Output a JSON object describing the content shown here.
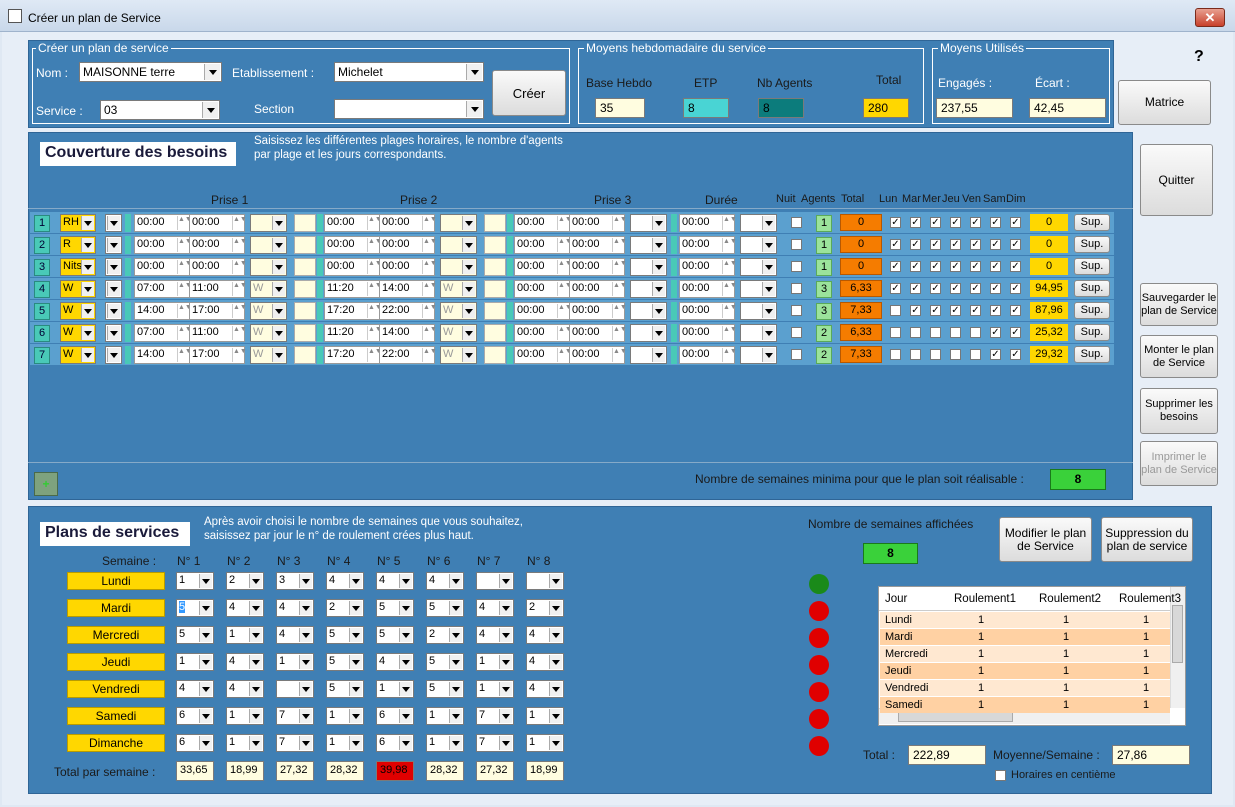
{
  "window": {
    "title": "Créer un plan de Service",
    "close": "✕"
  },
  "create": {
    "legend": "Créer un plan de service",
    "nom_label": "Nom :",
    "nom_value": "MAISONNE terre",
    "etab_label": "Etablissement :",
    "etab_value": "Michelet",
    "service_label": "Service :",
    "service_value": "03",
    "section_label": "Section",
    "section_value": "",
    "creer": "Créer"
  },
  "moyens": {
    "legend": "Moyens hebdomadaire du service",
    "base_label": "Base Hebdo",
    "base_value": "35",
    "etp_label": "ETP",
    "etp_value": "8",
    "nb_label": "Nb Agents",
    "nb_value": "8",
    "total_label": "Total",
    "total_value": "280"
  },
  "utilises": {
    "legend": "Moyens Utilisés",
    "engages_label": "Engagés :",
    "engages_value": "237,55",
    "ecart_label": "Écart :",
    "ecart_value": "42,45"
  },
  "help": "?",
  "buttons": {
    "matrice": "Matrice",
    "quitter": "Quitter",
    "sauvegarder": "Sauvegarder le plan de Service",
    "monter": "Monter le plan de Service",
    "supprimer": "Supprimer les besoins",
    "imprimer": "Imprimer le plan de Service",
    "modifier": "Modifier le plan de Service",
    "suppression": "Suppression du plan de service",
    "add": "+"
  },
  "couverture": {
    "title": "Couverture des besoins",
    "desc1": "Saisissez les différentes plages horaires, le nombre d'agents",
    "desc2": "par plage et les jours correspondants.",
    "headers": {
      "prise1": "Prise 1",
      "prise2": "Prise 2",
      "prise3": "Prise 3",
      "duree": "Durée",
      "nuit": "Nuit",
      "agents": "Agents",
      "total": "Total",
      "lun": "Lun",
      "mar": "Mar",
      "mer": "Mer",
      "jeu": "Jeu",
      "ven": "Ven",
      "sam": "Sam",
      "dim": "Dim"
    },
    "rows": [
      {
        "n": "1",
        "code": "RH",
        "p1a": "00:00",
        "p1b": "00:00",
        "p1w": "",
        "p2a": "00:00",
        "p2b": "00:00",
        "p2w": "",
        "p3a": "00:00",
        "p3b": "00:00",
        "duree": "00:00",
        "agents": "1",
        "total": "0",
        "days": [
          1,
          1,
          1,
          1,
          1,
          1,
          1
        ],
        "sum": "0",
        "sup": "Sup."
      },
      {
        "n": "2",
        "code": "R",
        "p1a": "00:00",
        "p1b": "00:00",
        "p1w": "",
        "p2a": "00:00",
        "p2b": "00:00",
        "p2w": "",
        "p3a": "00:00",
        "p3b": "00:00",
        "duree": "00:00",
        "agents": "1",
        "total": "0",
        "days": [
          1,
          1,
          1,
          1,
          1,
          1,
          1
        ],
        "sum": "0",
        "sup": "Sup."
      },
      {
        "n": "3",
        "code": "Nits",
        "p1a": "00:00",
        "p1b": "00:00",
        "p1w": "",
        "p2a": "00:00",
        "p2b": "00:00",
        "p2w": "",
        "p3a": "00:00",
        "p3b": "00:00",
        "duree": "00:00",
        "agents": "1",
        "total": "0",
        "days": [
          1,
          1,
          1,
          1,
          1,
          1,
          1
        ],
        "sum": "0",
        "sup": "Sup."
      },
      {
        "n": "4",
        "code": "W",
        "p1a": "07:00",
        "p1b": "11:00",
        "p1w": "W",
        "p2a": "11:20",
        "p2b": "14:00",
        "p2w": "W",
        "p3a": "00:00",
        "p3b": "00:00",
        "duree": "00:00",
        "agents": "3",
        "total": "6,33",
        "days": [
          1,
          1,
          1,
          1,
          1,
          1,
          1
        ],
        "sum": "94,95",
        "sup": "Sup."
      },
      {
        "n": "5",
        "code": "W",
        "p1a": "14:00",
        "p1b": "17:00",
        "p1w": "W",
        "p2a": "17:20",
        "p2b": "22:00",
        "p2w": "W",
        "p3a": "00:00",
        "p3b": "00:00",
        "duree": "00:00",
        "agents": "3",
        "total": "7,33",
        "days": [
          0,
          1,
          1,
          1,
          1,
          1,
          1
        ],
        "sum": "87,96",
        "sup": "Sup."
      },
      {
        "n": "6",
        "code": "W",
        "p1a": "07:00",
        "p1b": "11:00",
        "p1w": "W",
        "p2a": "11:20",
        "p2b": "14:00",
        "p2w": "W",
        "p3a": "00:00",
        "p3b": "00:00",
        "duree": "00:00",
        "agents": "2",
        "total": "6,33",
        "days": [
          0,
          0,
          0,
          0,
          0,
          1,
          1
        ],
        "sum": "25,32",
        "sup": "Sup."
      },
      {
        "n": "7",
        "code": "W",
        "p1a": "14:00",
        "p1b": "17:00",
        "p1w": "W",
        "p2a": "17:20",
        "p2b": "22:00",
        "p2w": "W",
        "p3a": "00:00",
        "p3b": "00:00",
        "duree": "00:00",
        "agents": "2",
        "total": "7,33",
        "days": [
          0,
          0,
          0,
          0,
          0,
          1,
          1
        ],
        "sum": "29,32",
        "sup": "Sup."
      }
    ],
    "minima_label": "Nombre de semaines minima pour que le plan soit réalisable :",
    "minima_value": "8"
  },
  "plans": {
    "title": "Plans de services",
    "desc1": "Après avoir choisi le nombre de semaines que vous souhaitez,",
    "desc2": "saisissez par jour le n° de roulement crées plus haut.",
    "semaine_label": "Semaine :",
    "weeks": [
      "N° 1",
      "N° 2",
      "N° 3",
      "N° 4",
      "N° 5",
      "N° 6",
      "N° 7",
      "N° 8"
    ],
    "days": [
      {
        "name": "Lundi",
        "vals": [
          "1",
          "2",
          "3",
          "4",
          "4",
          "4",
          "",
          ""
        ]
      },
      {
        "name": "Mardi",
        "vals": [
          "5",
          "4",
          "4",
          "2",
          "5",
          "5",
          "4",
          "2"
        ]
      },
      {
        "name": "Mercredi",
        "vals": [
          "5",
          "1",
          "4",
          "5",
          "5",
          "2",
          "4",
          "4"
        ]
      },
      {
        "name": "Jeudi",
        "vals": [
          "1",
          "4",
          "1",
          "5",
          "4",
          "5",
          "1",
          "4"
        ]
      },
      {
        "name": "Vendredi",
        "vals": [
          "4",
          "4",
          "",
          "5",
          "1",
          "5",
          "1",
          "4"
        ]
      },
      {
        "name": "Samedi",
        "vals": [
          "6",
          "1",
          "7",
          "1",
          "6",
          "1",
          "7",
          "1"
        ]
      },
      {
        "name": "Dimanche",
        "vals": [
          "6",
          "1",
          "7",
          "1",
          "6",
          "1",
          "7",
          "1"
        ]
      }
    ],
    "total_label": "Total par semaine :",
    "totals": [
      "33,65",
      "18,99",
      "27,32",
      "28,32",
      "39,98",
      "28,32",
      "27,32",
      "18,99"
    ],
    "nb_affichees_label": "Nombre de semaines affichées",
    "nb_affichees_value": "8",
    "dots": [
      "#1a8a1a",
      "#e00000",
      "#e00000",
      "#e00000",
      "#e00000",
      "#e00000",
      "#e00000"
    ],
    "grid_headers": [
      "Jour",
      "Roulement1",
      "Roulement2",
      "Roulement3"
    ],
    "grid_rows": [
      [
        "Lundi",
        "1",
        "1",
        "1"
      ],
      [
        "Mardi",
        "1",
        "1",
        "1"
      ],
      [
        "Mercredi",
        "1",
        "1",
        "1"
      ],
      [
        "Jeudi",
        "1",
        "1",
        "1"
      ],
      [
        "Vendredi",
        "1",
        "1",
        "1"
      ],
      [
        "Samedi",
        "1",
        "1",
        "1"
      ]
    ],
    "total_label2": "Total :",
    "total_value": "222,89",
    "moyenne_label": "Moyenne/Semaine :",
    "moyenne_value": "27,86",
    "centieme_label": "Horaires en centième"
  }
}
